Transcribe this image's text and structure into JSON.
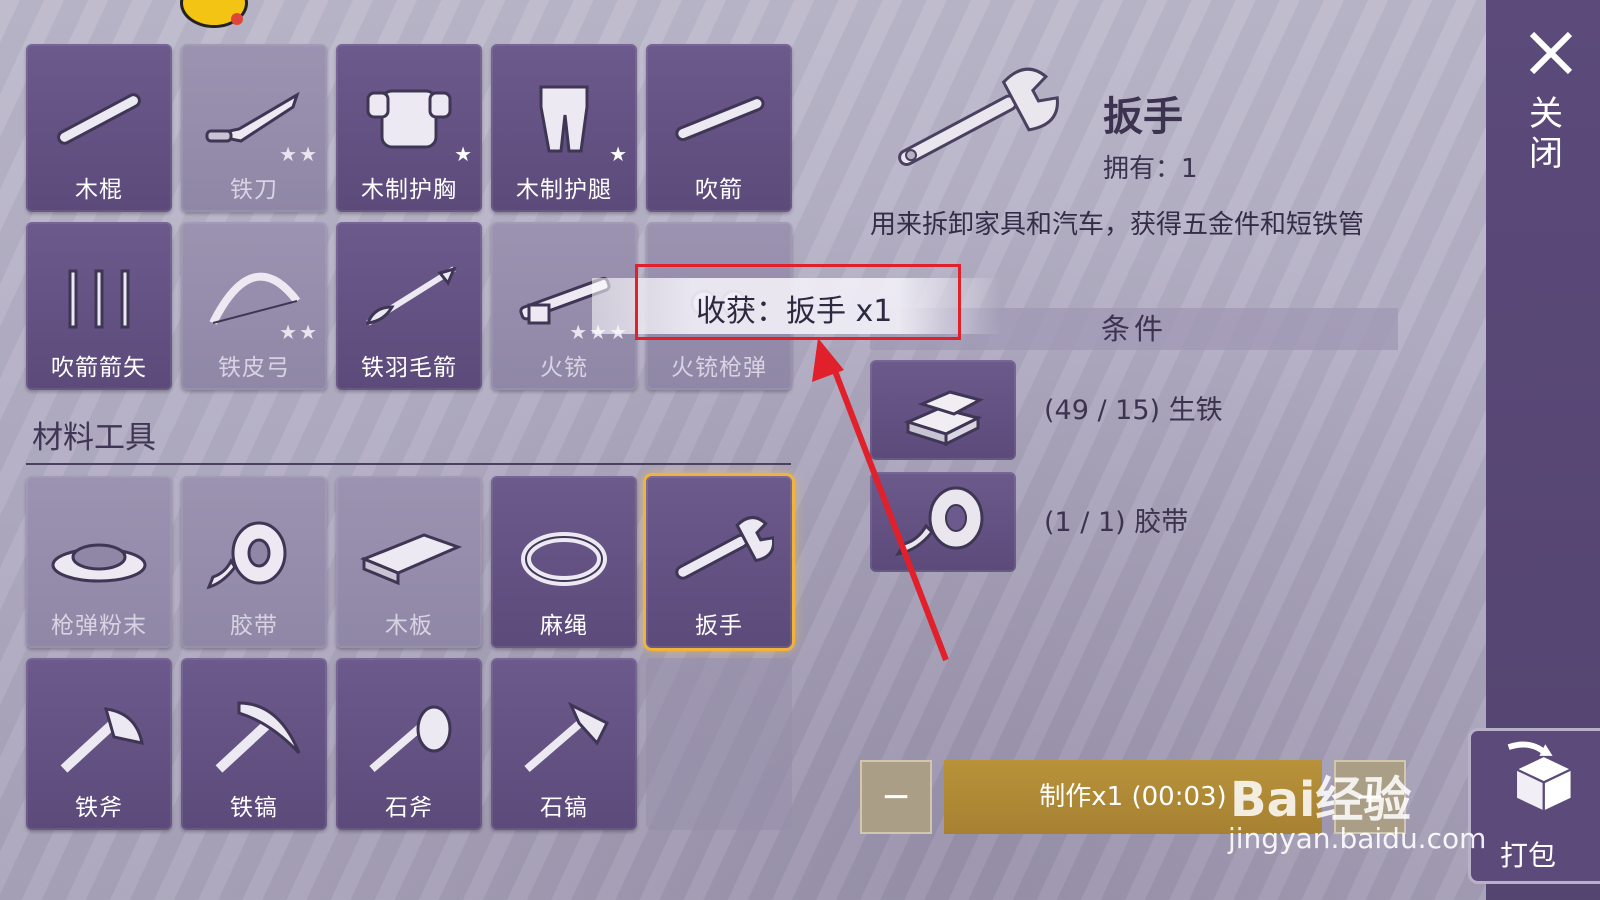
{
  "grid_top": [
    {
      "label": "木棍",
      "icon": "stick-icon",
      "dim": false,
      "stars": ""
    },
    {
      "label": "铁刀",
      "icon": "iron-knife-icon",
      "dim": true,
      "stars": "★★"
    },
    {
      "label": "木制护胸",
      "icon": "wood-chestguard-icon",
      "dim": false,
      "stars": "★"
    },
    {
      "label": "木制护腿",
      "icon": "wood-legguard-icon",
      "dim": false,
      "stars": "★"
    },
    {
      "label": "吹箭",
      "icon": "blowgun-icon",
      "dim": false,
      "stars": ""
    },
    {
      "label": "吹箭箭矢",
      "icon": "darts-icon",
      "dim": false,
      "stars": ""
    },
    {
      "label": "铁皮弓",
      "icon": "iron-bow-icon",
      "dim": true,
      "stars": "★★"
    },
    {
      "label": "铁羽毛箭",
      "icon": "feather-arrow-icon",
      "dim": false,
      "stars": ""
    },
    {
      "label": "火铳",
      "icon": "musket-icon",
      "dim": true,
      "stars": "★★★"
    },
    {
      "label": "火铳枪弹",
      "icon": "musket-ammo-icon",
      "dim": true,
      "stars": ""
    }
  ],
  "section_title": "材料工具",
  "grid_materials": [
    {
      "label": "枪弹粉末",
      "icon": "gunpowder-icon",
      "dim": true
    },
    {
      "label": "胶带",
      "icon": "tape-icon",
      "dim": true
    },
    {
      "label": "木板",
      "icon": "plank-icon",
      "dim": true
    },
    {
      "label": "麻绳",
      "icon": "rope-icon",
      "dim": false
    },
    {
      "label": "扳手",
      "icon": "wrench-icon",
      "dim": false,
      "selected": true
    },
    {
      "label": "铁斧",
      "icon": "iron-axe-icon",
      "dim": false
    },
    {
      "label": "铁镐",
      "icon": "iron-pickaxe-icon",
      "dim": false
    },
    {
      "label": "石斧",
      "icon": "stone-axe-icon",
      "dim": false
    },
    {
      "label": "石镐",
      "icon": "stone-pickaxe-icon",
      "dim": false
    },
    {
      "label": "",
      "icon": "",
      "empty": true
    }
  ],
  "detail": {
    "name": "扳手",
    "owned": "拥有：1",
    "description": "用来拆卸家具和汽车，获得五金件和短铁管",
    "conditions_title": "条件",
    "requirements": [
      {
        "text": "(49 / 15) 生铁",
        "icon": "iron-ingot-icon"
      },
      {
        "text": "(1 / 1) 胶带",
        "icon": "tape-icon"
      }
    ]
  },
  "toast": {
    "text": "收获：扳手 x1"
  },
  "craft": {
    "minus": "−",
    "make_label": "制作x1 (00:03)",
    "plus": "+"
  },
  "right_rail": {
    "close_label": "关闭",
    "pack_label": "打包"
  },
  "watermark": {
    "brand": "Bai经验",
    "url": "jingyan.baidu.com"
  },
  "colors": {
    "tile": "#5b4a7a",
    "selected_glow": "#f0b43a",
    "annotation_red": "#e0202a",
    "craft_button": "#b8923a"
  }
}
